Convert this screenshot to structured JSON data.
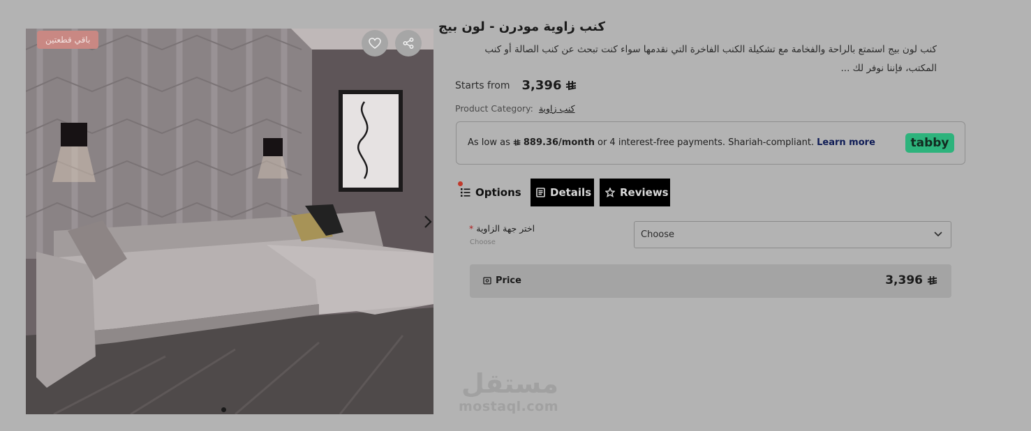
{
  "product": {
    "stock_badge": "باقي قطعتين",
    "title": "كنب زاوية مودرن - لون بيج",
    "description_line1": "كنب لون بيج استمتع بالراحة والفخامة مع تشكيلة الكنب الفاخرة التي نقدمها سواء كنت تبحث عن كنب الصالة أو كنب",
    "description_line2": "المكتب، فإننا نوفر لك ...",
    "starts_from_label": "Starts from",
    "price": "3,396",
    "category_label": "Product Category:",
    "category_value": "كنب زاوية"
  },
  "tabby": {
    "prefix": "As low as",
    "amount": "889.36/month",
    "suffix": "or 4 interest-free payments. Shariah-compliant.",
    "learn_more": "Learn more",
    "logo": "tabby"
  },
  "tabs": [
    {
      "label": "Options",
      "icon": "list-icon"
    },
    {
      "label": "Details",
      "icon": "document-icon"
    },
    {
      "label": "Reviews",
      "icon": "star-icon"
    }
  ],
  "option": {
    "label": "اختر جهة الزاوية",
    "required_mark": "*",
    "hint": "Choose",
    "select_value": "Choose"
  },
  "price_summary": {
    "label": "Price",
    "value": "3,396"
  },
  "watermark": {
    "arabic": "مستقل",
    "latin": "mostaql.com"
  },
  "colors": {
    "overlay_bg": "#b3b3b3",
    "tabby_green": "#2db37c",
    "badge": "#c98883",
    "tab_active_bg": "#000000"
  }
}
